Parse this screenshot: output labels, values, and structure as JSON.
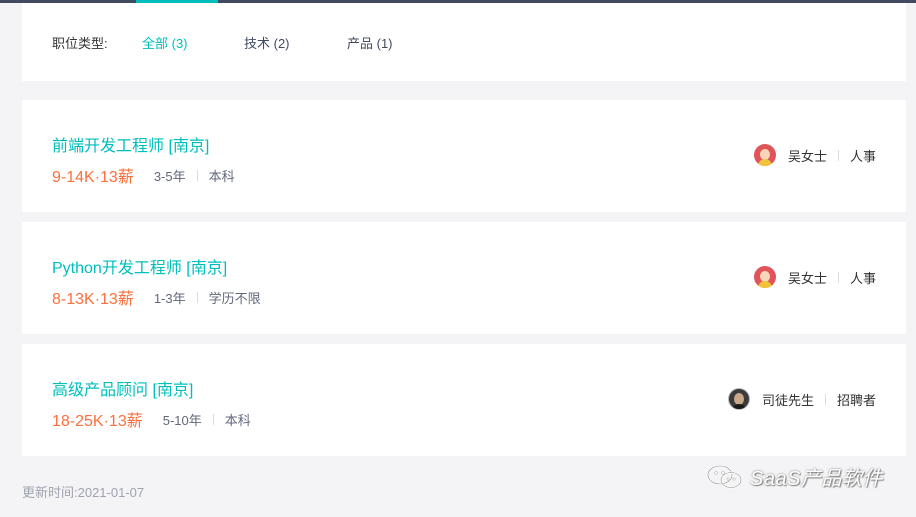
{
  "filter": {
    "label": "职位类型:",
    "tabs": [
      {
        "label": "全部 (3)",
        "active": true
      },
      {
        "label": "技术 (2)",
        "active": false
      },
      {
        "label": "产品 (1)",
        "active": false
      }
    ]
  },
  "jobs": [
    {
      "title": "前端开发工程师  [南京]",
      "salary": "9-14K·13薪",
      "experience": "3-5年",
      "education": "本科",
      "recruiter_name": "吴女士",
      "recruiter_role": "人事",
      "avatar": "female-avatar-icon"
    },
    {
      "title": "Python开发工程师  [南京]",
      "salary": "8-13K·13薪",
      "experience": "1-3年",
      "education": "学历不限",
      "recruiter_name": "吴女士",
      "recruiter_role": "人事",
      "avatar": "female-avatar-icon"
    },
    {
      "title": "高级产品顾问  [南京]",
      "salary": "18-25K·13薪",
      "experience": "5-10年",
      "education": "本科",
      "recruiter_name": "司徒先生",
      "recruiter_role": "招聘者",
      "avatar": "male-avatar-icon"
    }
  ],
  "update_time": "更新时间:2021-01-07",
  "watermark": "SaaS产品软件",
  "colors": {
    "accent": "#00bebd",
    "salary": "#fc703e",
    "topbar": "#414a60",
    "background": "#f4f4f6"
  }
}
